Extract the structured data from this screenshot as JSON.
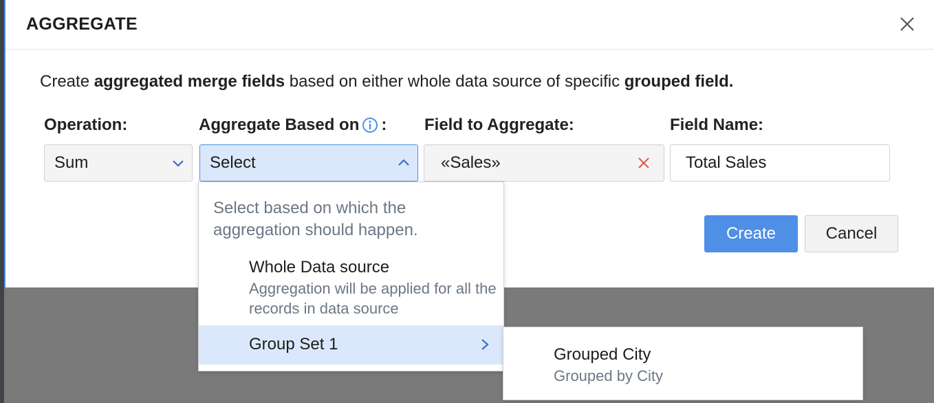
{
  "dialog": {
    "title": "AGGREGATE",
    "description": {
      "p1": "Create ",
      "b1": "aggregated merge fields",
      "p2": " based on either whole data source of specific ",
      "b2": "grouped field."
    }
  },
  "form": {
    "operation": {
      "label": "Operation:",
      "value": "Sum"
    },
    "aggregate_based_on": {
      "label": "Aggregate Based on",
      "label_suffix": ":",
      "value": "Select"
    },
    "field_to_aggregate": {
      "label": "Field to Aggregate:",
      "value": "«Sales»"
    },
    "field_name": {
      "label": "Field Name:",
      "value": "Total Sales"
    }
  },
  "buttons": {
    "create": "Create",
    "cancel": "Cancel"
  },
  "dropdown": {
    "hint": "Select based on which the aggregation should happen.",
    "options": [
      {
        "title": "Whole Data source",
        "subtitle": "Aggregation will be applied for all the records in data source"
      }
    ],
    "group": {
      "label": "Group Set 1"
    }
  },
  "submenu": {
    "items": [
      {
        "title": "Grouped City",
        "subtitle": "Grouped by City"
      }
    ]
  },
  "colors": {
    "accent": "#4f8fe6",
    "highlight": "#dbe8fb",
    "muted_text": "#6b7785",
    "clear_icon": "#e2574c"
  }
}
